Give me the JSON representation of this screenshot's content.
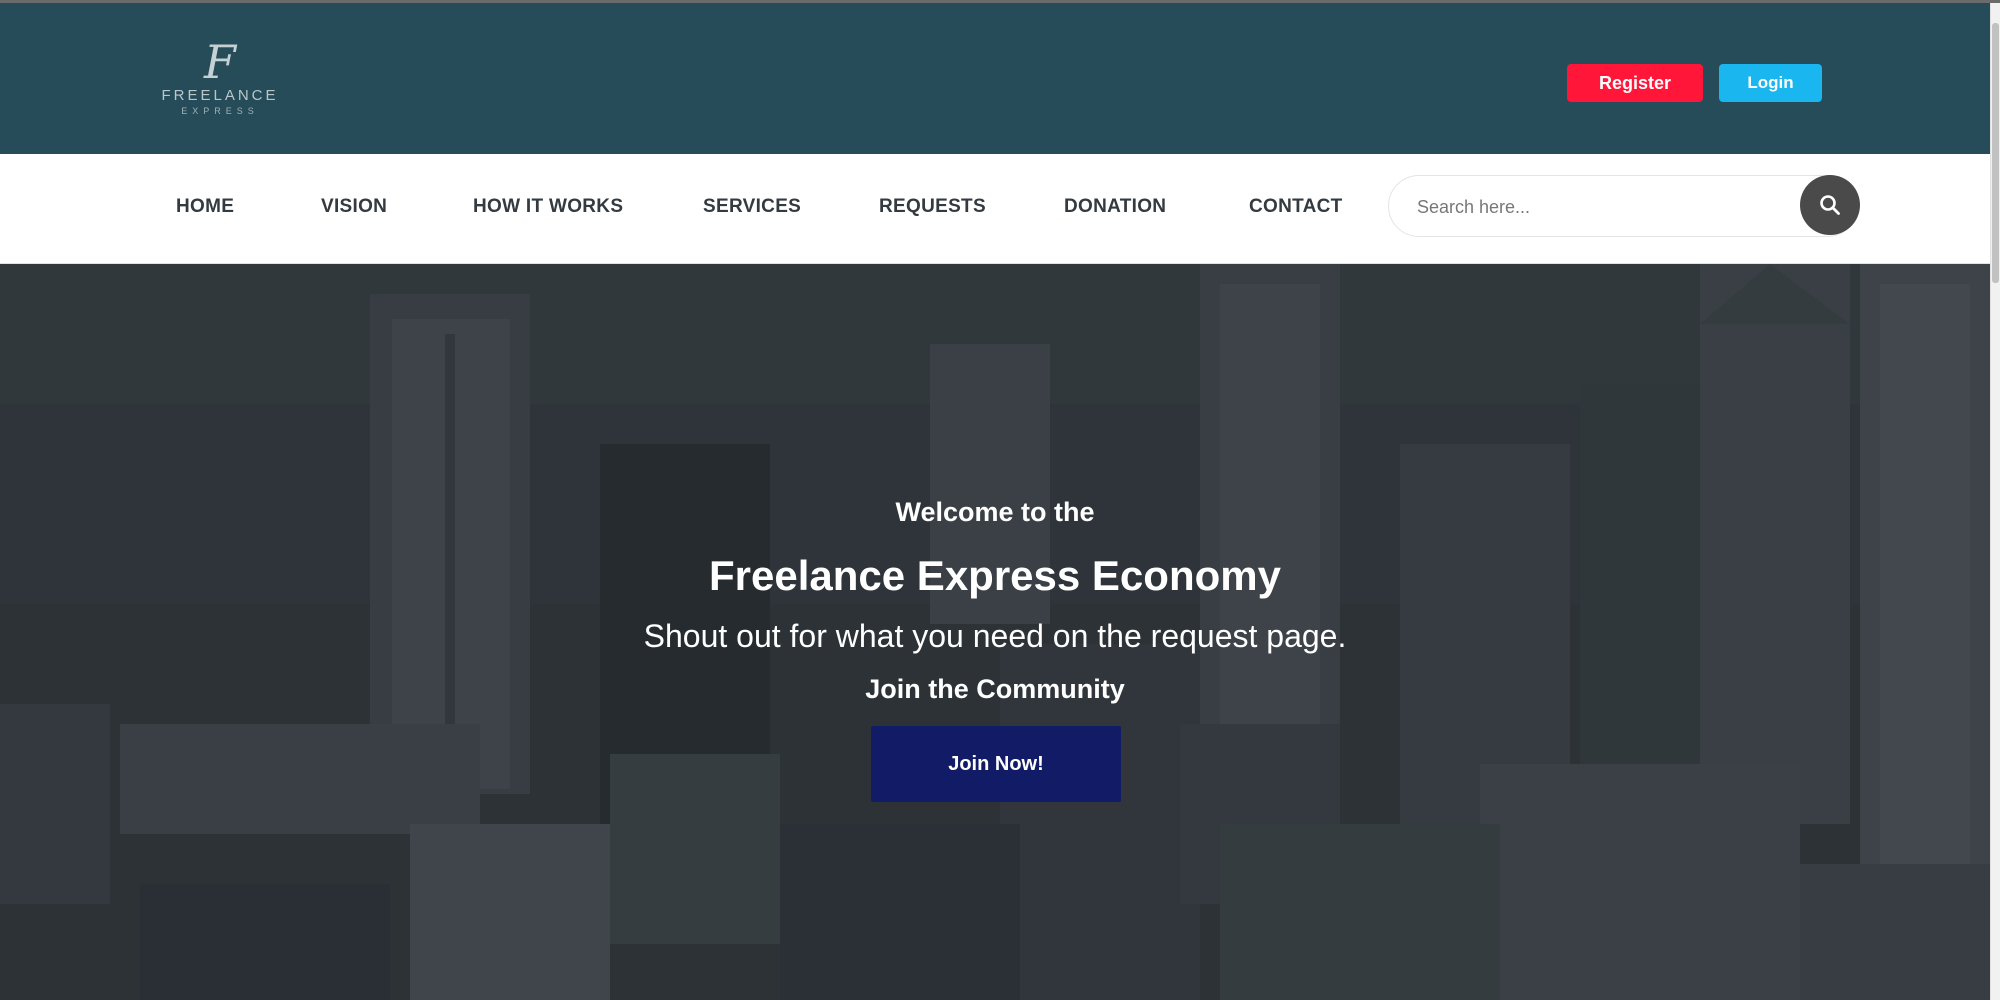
{
  "header": {
    "logo": {
      "mark": "F",
      "name": "FREELANCE",
      "sub": "EXPRESS"
    },
    "register_label": "Register",
    "login_label": "Login"
  },
  "nav": {
    "items": [
      {
        "label": "HOME"
      },
      {
        "label": "VISION"
      },
      {
        "label": "HOW IT WORKS"
      },
      {
        "label": "SERVICES"
      },
      {
        "label": "REQUESTS"
      },
      {
        "label": "DONATION"
      },
      {
        "label": "CONTACT"
      }
    ]
  },
  "search": {
    "placeholder": "Search here...",
    "value": ""
  },
  "hero": {
    "welcome": "Welcome to the",
    "title": "Freelance Express Economy",
    "subtitle": "Shout out for what you need on the request page.",
    "join_text": "Join the Community",
    "join_button": "Join Now!"
  },
  "colors": {
    "header_bg": "#254c58",
    "register": "#ff1638",
    "login": "#1ab6f0",
    "join_button": "#121c66",
    "search_button": "#4a4a4a"
  },
  "icons": {
    "search": "search-icon"
  }
}
